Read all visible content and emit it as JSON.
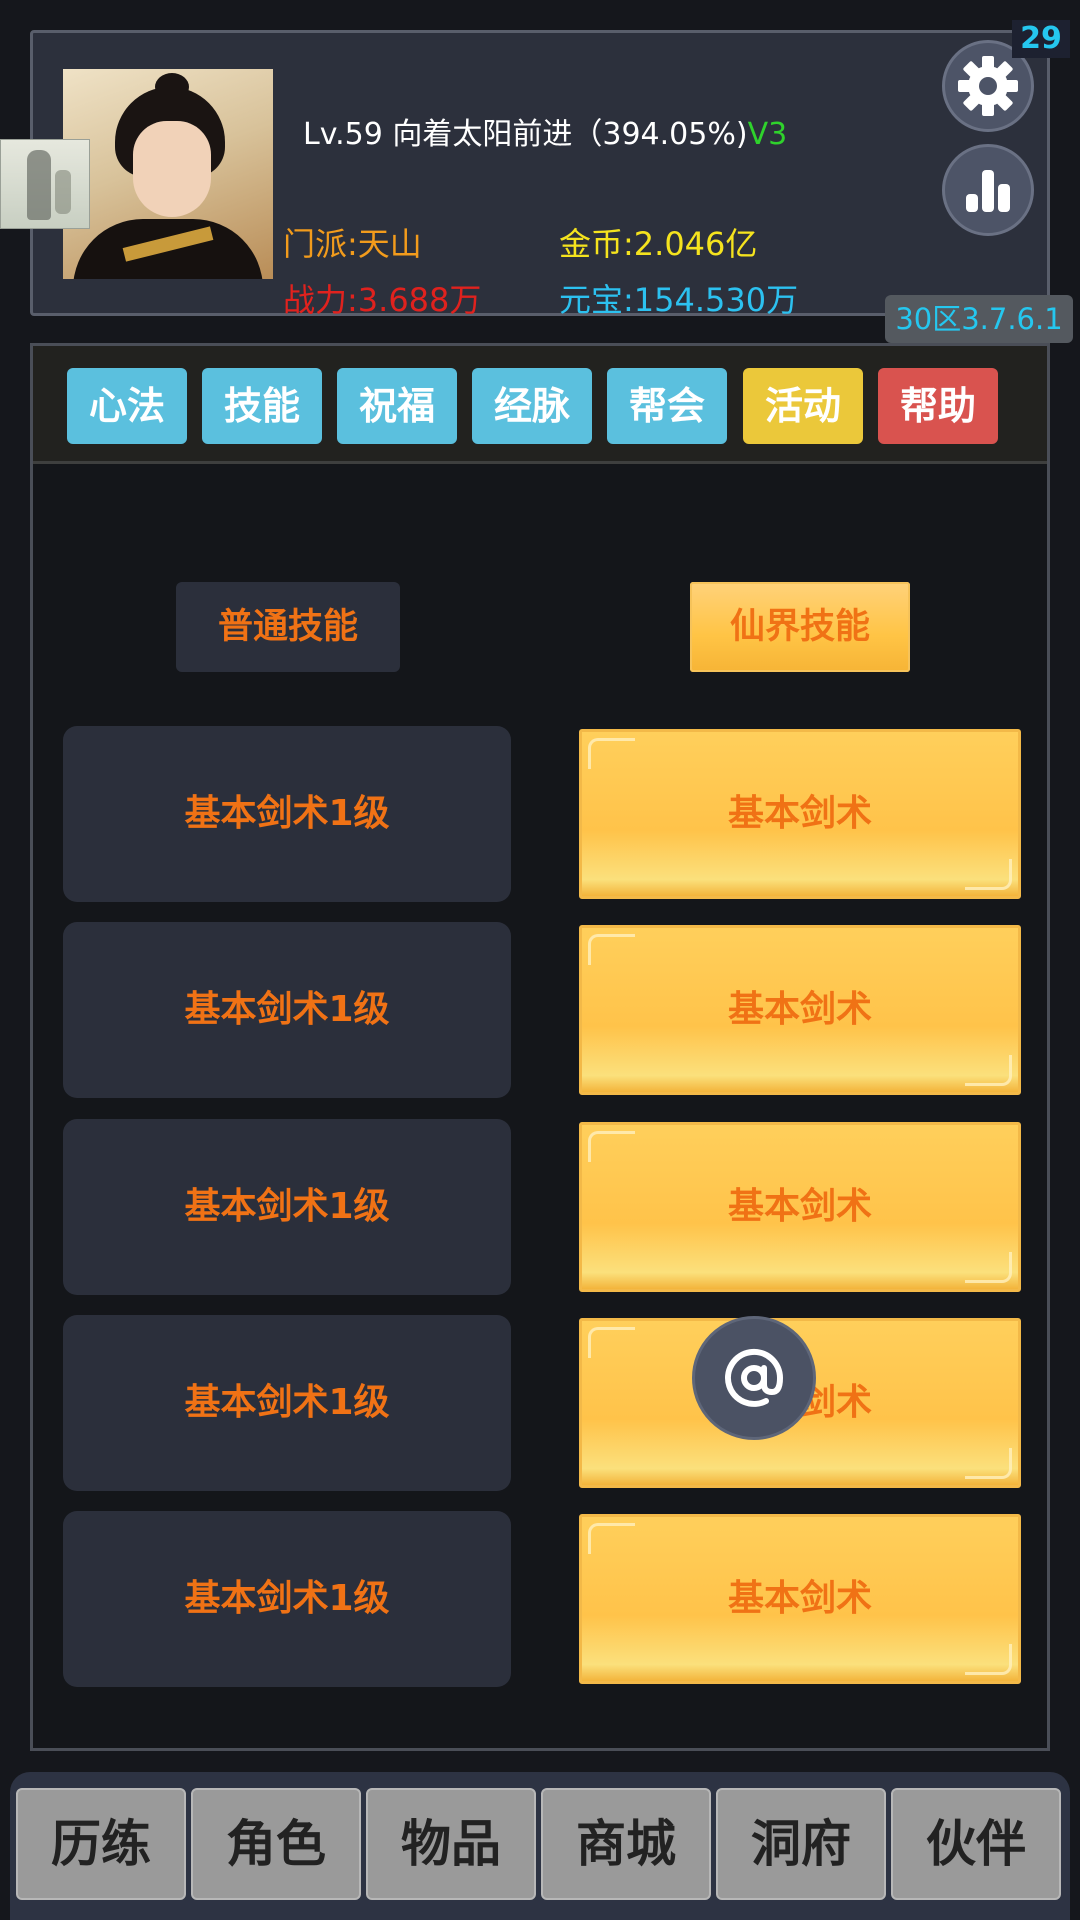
{
  "header": {
    "level_line": "Lv.59 向着太阳前进（394.05%)",
    "vip": "V3",
    "sect": "门派:天山",
    "power": "战力:3.688万",
    "gold": "金币:2.046亿",
    "yuanbao": "元宝:154.530万",
    "notification_count": "29",
    "server": "30区3.7.6.1",
    "icons": {
      "settings": "gear-icon",
      "stats": "bar-chart-icon"
    }
  },
  "tabs": [
    {
      "label": "心法",
      "color": "#5bc0de"
    },
    {
      "label": "技能",
      "color": "#5bc0de"
    },
    {
      "label": "祝福",
      "color": "#5bc0de"
    },
    {
      "label": "经脉",
      "color": "#5bc0de"
    },
    {
      "label": "帮会",
      "color": "#5bc0de"
    },
    {
      "label": "活动",
      "color": "#ebc83a"
    },
    {
      "label": "帮助",
      "color": "#d9534f"
    }
  ],
  "skill_panel": {
    "normal_title": "普通技能",
    "immortal_title": "仙界技能",
    "normal_skills": [
      "基本剑术1级",
      "基本剑术1级",
      "基本剑术1级",
      "基本剑术1级",
      "基本剑术1级"
    ],
    "immortal_skills": [
      "基本剑术",
      "基本剑术",
      "基本剑术",
      "基本剑术",
      "基本剑术"
    ]
  },
  "floating_button": {
    "icon": "at-sign-icon"
  },
  "bottom_nav": [
    "历练",
    "角色",
    "物品",
    "商城",
    "洞府",
    "伙伴"
  ],
  "colors": {
    "skill_text": "#f07215",
    "power": "#e0221e",
    "gold": "#f5e31e",
    "yuanbao": "#2cc1f0",
    "sect": "#f29b1c",
    "vip": "#2fd22c",
    "server": "#25c7ef"
  }
}
